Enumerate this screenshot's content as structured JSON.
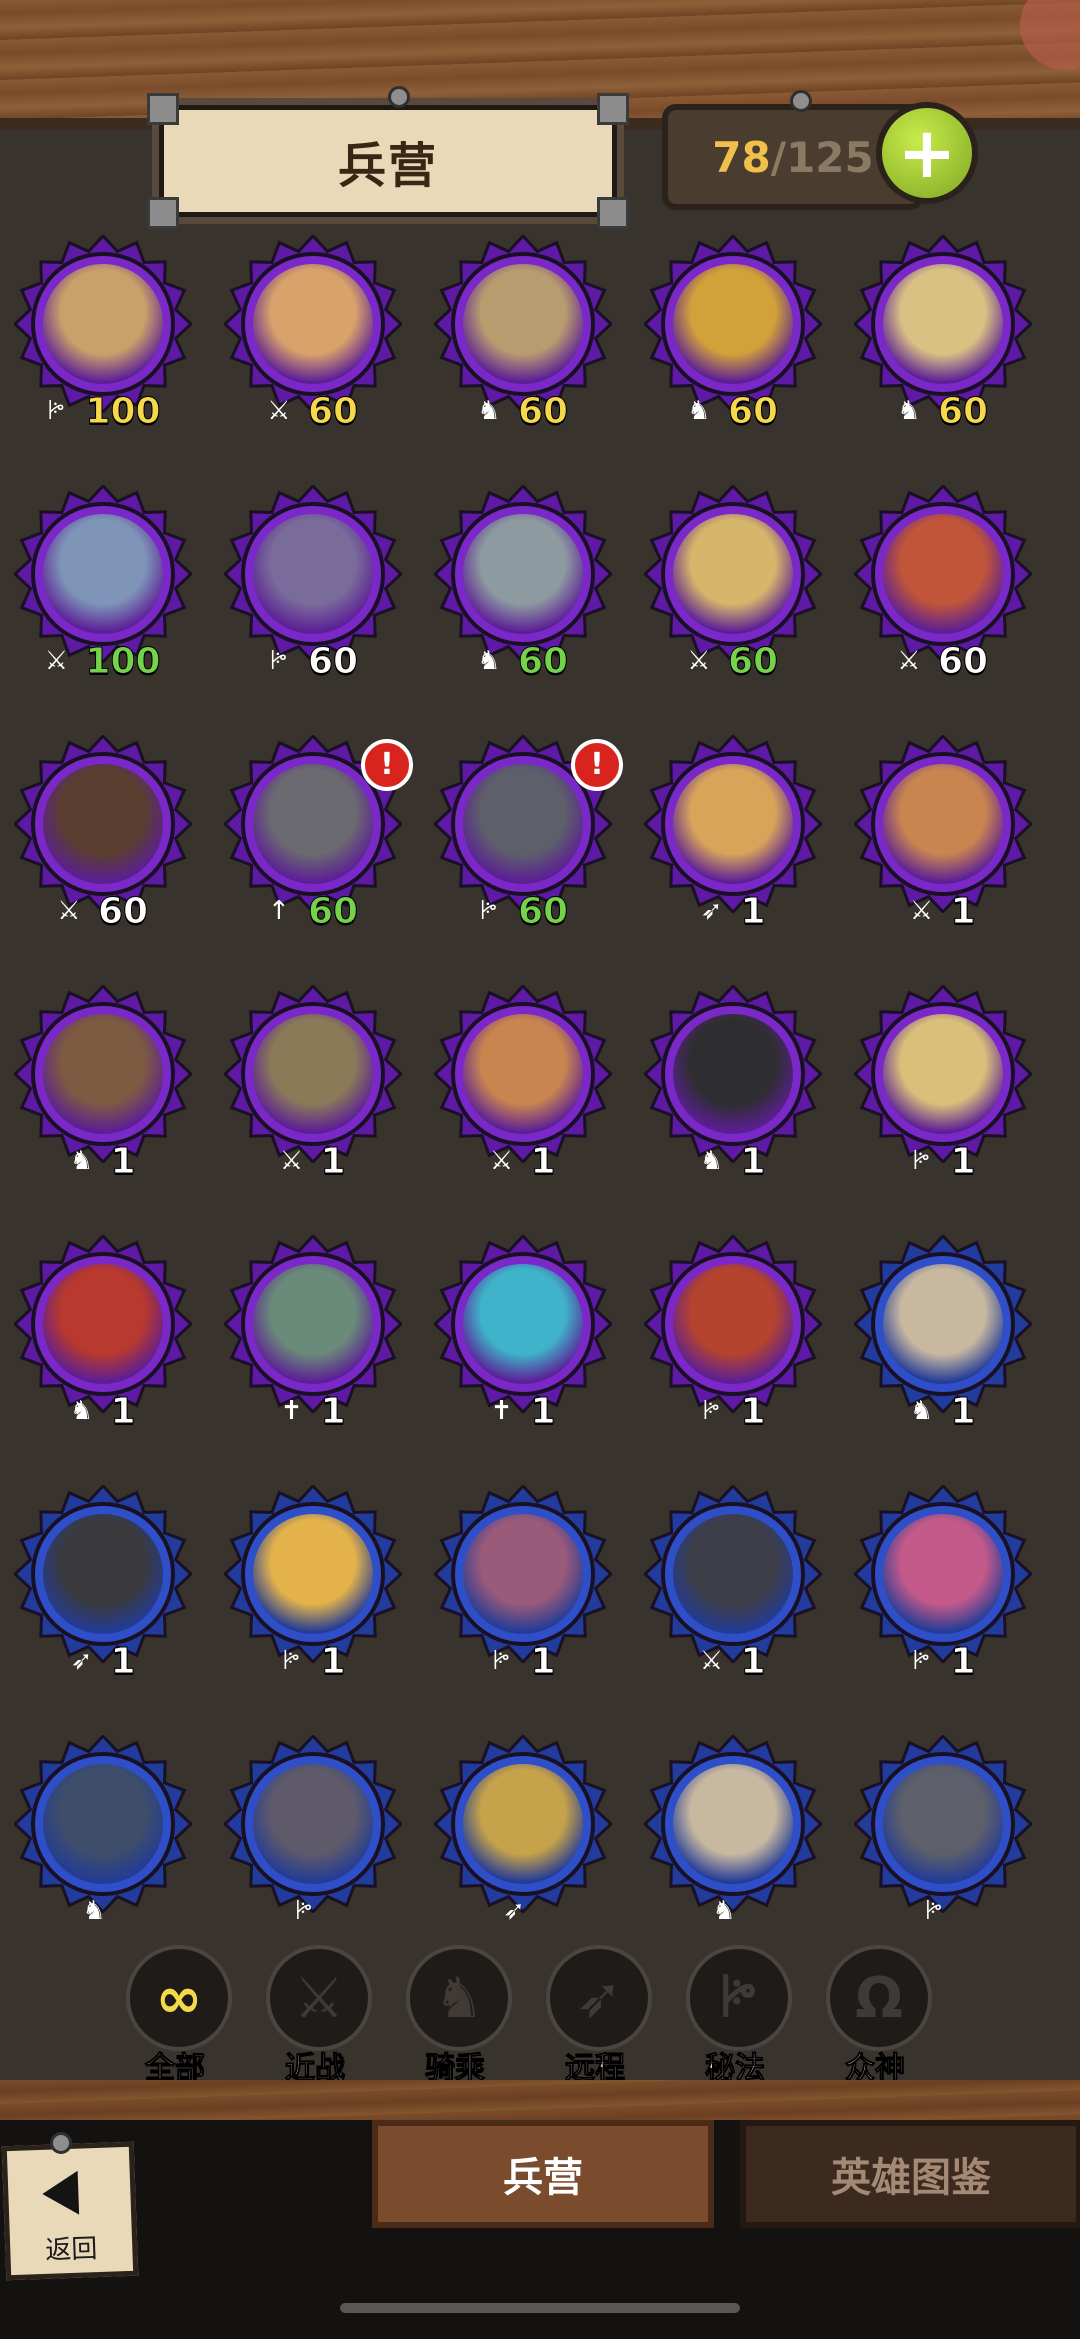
{
  "header": {
    "title": "兵营",
    "capacity_current": "78",
    "capacity_sep": "/",
    "capacity_max": "125",
    "add_label": "+"
  },
  "units": [
    {
      "cls": "arcane",
      "tier": "purple",
      "count": "100",
      "count_color": "yellow",
      "alert": false,
      "art": "#c9a06a"
    },
    {
      "cls": "melee",
      "tier": "purple",
      "count": "60",
      "count_color": "yellow",
      "alert": false,
      "art": "#d8a26b"
    },
    {
      "cls": "mounted",
      "tier": "purple",
      "count": "60",
      "count_color": "yellow",
      "alert": false,
      "art": "#b79c6f"
    },
    {
      "cls": "mounted",
      "tier": "purple",
      "count": "60",
      "count_color": "yellow",
      "alert": false,
      "art": "#d1a23a"
    },
    {
      "cls": "mounted",
      "tier": "purple",
      "count": "60",
      "count_color": "yellow",
      "alert": false,
      "art": "#d8c183"
    },
    {
      "cls": "melee",
      "tier": "purple",
      "count": "100",
      "count_color": "green",
      "alert": false,
      "art": "#7e95b8"
    },
    {
      "cls": "arcane",
      "tier": "purple",
      "count": "60",
      "count_color": "white",
      "alert": false,
      "art": "#7a6c9a"
    },
    {
      "cls": "mounted",
      "tier": "purple",
      "count": "60",
      "count_color": "green",
      "alert": false,
      "art": "#8d9aa0"
    },
    {
      "cls": "melee",
      "tier": "purple",
      "count": "60",
      "count_color": "green",
      "alert": false,
      "art": "#d5b66a"
    },
    {
      "cls": "melee",
      "tier": "purple",
      "count": "60",
      "count_color": "white",
      "alert": false,
      "art": "#c0553a"
    },
    {
      "cls": "melee",
      "tier": "purple",
      "count": "60",
      "count_color": "white",
      "alert": false,
      "art": "#5a3e30"
    },
    {
      "cls": "spear",
      "tier": "purple",
      "count": "60",
      "count_color": "green",
      "alert": true,
      "art": "#6b6a70"
    },
    {
      "cls": "arcane",
      "tier": "purple",
      "count": "60",
      "count_color": "green",
      "alert": true,
      "art": "#5d5f6a"
    },
    {
      "cls": "ranged",
      "tier": "purple",
      "count": "1",
      "count_color": "white",
      "alert": false,
      "art": "#d7a45a"
    },
    {
      "cls": "melee",
      "tier": "purple",
      "count": "1",
      "count_color": "white",
      "alert": false,
      "art": "#c98550"
    },
    {
      "cls": "mounted",
      "tier": "purple",
      "count": "1",
      "count_color": "white",
      "alert": false,
      "art": "#7d5a42"
    },
    {
      "cls": "melee",
      "tier": "purple",
      "count": "1",
      "count_color": "white",
      "alert": false,
      "art": "#8a7a58"
    },
    {
      "cls": "melee",
      "tier": "purple",
      "count": "1",
      "count_color": "white",
      "alert": false,
      "art": "#c98550"
    },
    {
      "cls": "mounted",
      "tier": "purple",
      "count": "1",
      "count_color": "white",
      "alert": false,
      "art": "#2e2e30"
    },
    {
      "cls": "arcane",
      "tier": "purple",
      "count": "1",
      "count_color": "white",
      "alert": false,
      "art": "#d9c07a"
    },
    {
      "cls": "mounted",
      "tier": "purple",
      "count": "1",
      "count_color": "white",
      "alert": false,
      "art": "#b8392d"
    },
    {
      "cls": "divine",
      "tier": "purple",
      "count": "1",
      "count_color": "white",
      "alert": false,
      "art": "#6a8a7a"
    },
    {
      "cls": "divine",
      "tier": "purple",
      "count": "1",
      "count_color": "white",
      "alert": false,
      "art": "#3fb3c9"
    },
    {
      "cls": "arcane",
      "tier": "purple",
      "count": "1",
      "count_color": "white",
      "alert": false,
      "art": "#b4442e"
    },
    {
      "cls": "mounted",
      "tier": "blue",
      "count": "1",
      "count_color": "white",
      "alert": false,
      "art": "#c9b8a0"
    },
    {
      "cls": "ranged",
      "tier": "blue",
      "count": "1",
      "count_color": "white",
      "alert": false,
      "art": "#3a3a3e"
    },
    {
      "cls": "arcane",
      "tier": "blue",
      "count": "1",
      "count_color": "white",
      "alert": false,
      "art": "#e3b24a"
    },
    {
      "cls": "arcane",
      "tier": "blue",
      "count": "1",
      "count_color": "white",
      "alert": false,
      "art": "#9a5a7a"
    },
    {
      "cls": "melee",
      "tier": "blue",
      "count": "1",
      "count_color": "white",
      "alert": false,
      "art": "#3e3e48"
    },
    {
      "cls": "arcane",
      "tier": "blue",
      "count": "1",
      "count_color": "white",
      "alert": false,
      "art": "#c45a8a"
    },
    {
      "cls": "mounted",
      "tier": "blue",
      "count": "",
      "count_color": "white",
      "alert": false,
      "art": "#3e4e6a"
    },
    {
      "cls": "arcane",
      "tier": "blue",
      "count": "",
      "count_color": "white",
      "alert": false,
      "art": "#5e5a6a"
    },
    {
      "cls": "ranged",
      "tier": "blue",
      "count": "",
      "count_color": "white",
      "alert": false,
      "art": "#c6a24a"
    },
    {
      "cls": "mounted",
      "tier": "blue",
      "count": "",
      "count_color": "white",
      "alert": false,
      "art": "#c9b8a0"
    },
    {
      "cls": "arcane",
      "tier": "blue",
      "count": "",
      "count_color": "white",
      "alert": false,
      "art": "#5d5f6a"
    }
  ],
  "class_icons": {
    "arcane": "ꔶ",
    "melee": "⚔",
    "mounted": "♞",
    "spear": "↑",
    "ranged": "➶",
    "divine": "✝"
  },
  "tier_colors": {
    "purple": "#7a28c8",
    "blue": "#2e4fc8",
    "purple_spike": "#5e1aa5",
    "blue_spike": "#223c9e"
  },
  "filters": [
    {
      "key": "all",
      "label": "全部",
      "icon": "∞",
      "active": true
    },
    {
      "key": "melee",
      "label": "近战",
      "icon": "⚔",
      "active": false
    },
    {
      "key": "mounted",
      "label": "骑乘",
      "icon": "♞",
      "active": false
    },
    {
      "key": "ranged",
      "label": "远程",
      "icon": "➶",
      "active": false
    },
    {
      "key": "arcane",
      "label": "秘法",
      "icon": "ꔶ",
      "active": false
    },
    {
      "key": "divine",
      "label": "众神",
      "icon": "Ω",
      "active": false
    }
  ],
  "tabs": {
    "barracks": "兵营",
    "heroes": "英雄图鉴"
  },
  "back": {
    "label": "返回"
  }
}
